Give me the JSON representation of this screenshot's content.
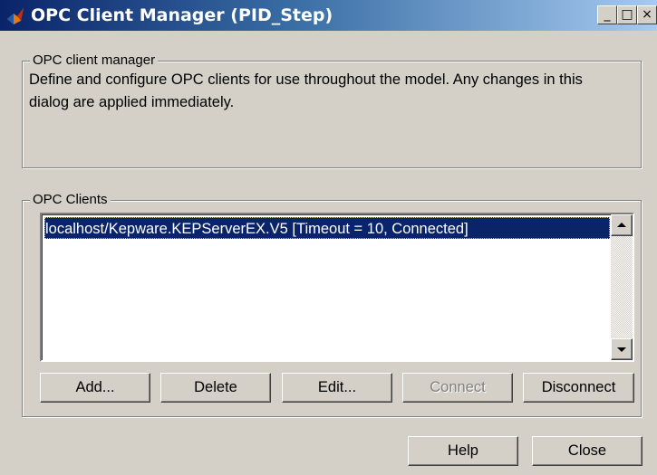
{
  "window": {
    "title": "OPC Client Manager (PID_Step)",
    "icon": "matlab-icon",
    "controls": {
      "minimize": "_",
      "maximize": "□",
      "close": "×"
    }
  },
  "manager_group": {
    "label": "OPC client manager",
    "description": "Define and configure OPC clients for use throughout the model. Any changes in this dialog are applied immediately."
  },
  "clients_group": {
    "label": "OPC Clients",
    "clients": [
      {
        "text": "localhost/Kepware.KEPServerEX.V5 [Timeout = 10, Connected]",
        "selected": true
      }
    ],
    "buttons": {
      "add": "Add...",
      "delete": "Delete",
      "edit": "Edit...",
      "connect": "Connect",
      "disconnect": "Disconnect"
    }
  },
  "footer": {
    "help": "Help",
    "close": "Close"
  },
  "colors": {
    "title_bar": "#0a246a",
    "selection": "#0a246a",
    "face": "#d4d0c8"
  }
}
